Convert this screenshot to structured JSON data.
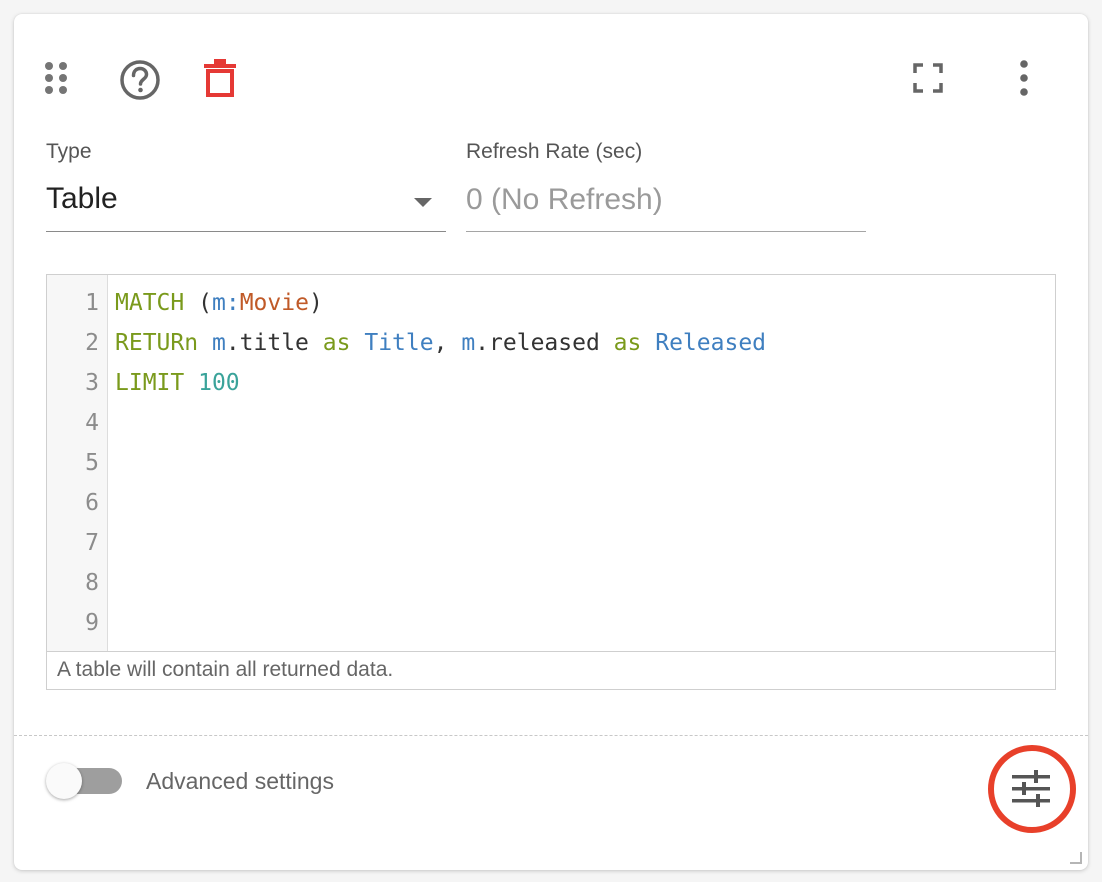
{
  "toolbar": {
    "drag_icon": "drag-handle-icon",
    "help_icon": "help-circle-icon",
    "delete_icon": "trash-icon",
    "fullscreen_icon": "fullscreen-icon",
    "more_icon": "more-vertical-icon",
    "delete_color": "#e53935"
  },
  "type_field": {
    "label": "Type",
    "value": "Table"
  },
  "refresh_field": {
    "label": "Refresh Rate (sec)",
    "placeholder": "0 (No Refresh)",
    "value": ""
  },
  "editor": {
    "line_numbers": [
      "1",
      "2",
      "3",
      "4",
      "5",
      "6",
      "7",
      "8",
      "9"
    ],
    "lines": [
      "MATCH (m:Movie)",
      "RETURn m.title as Title, m.released as Released",
      "LIMIT 100"
    ],
    "help_text": "A table will contain all returned data."
  },
  "footer": {
    "advanced_label": "Advanced settings",
    "advanced_enabled": false,
    "settings_icon": "tune-sliders-icon",
    "highlight_color": "#e8402a"
  }
}
